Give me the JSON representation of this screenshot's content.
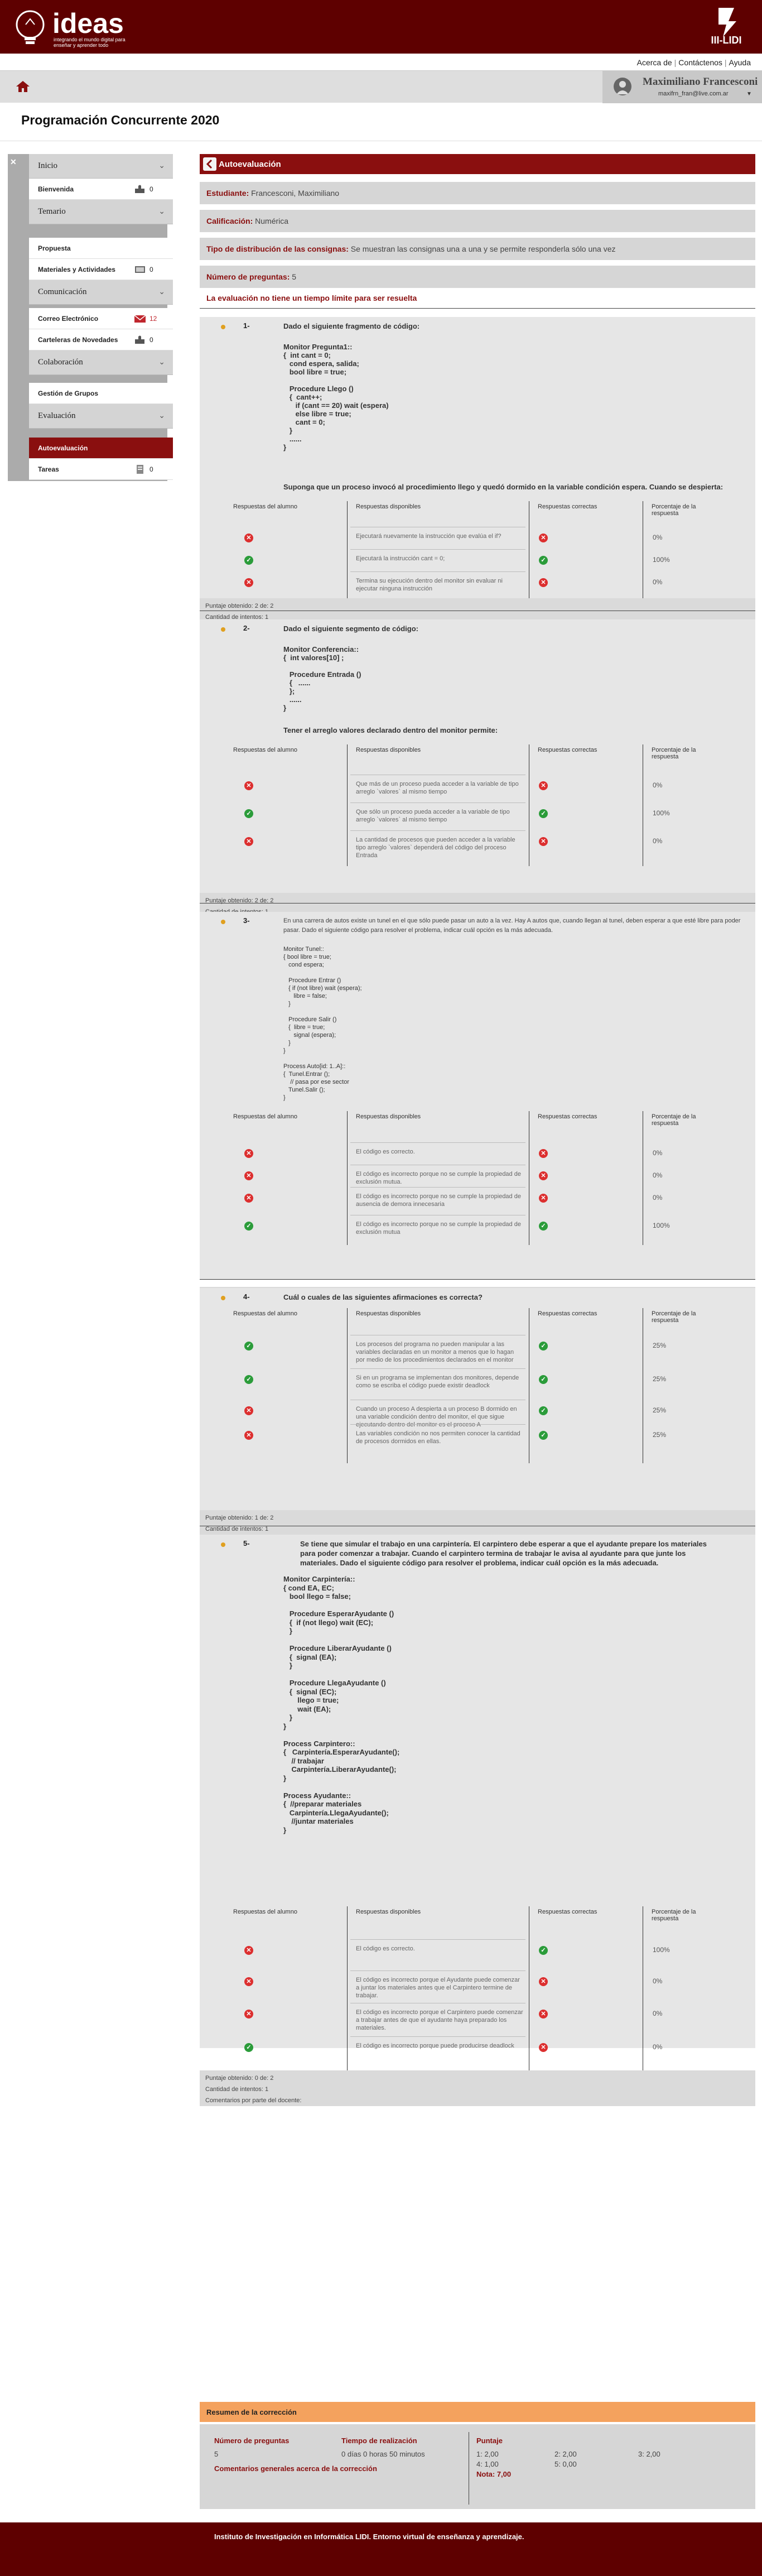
{
  "header": {
    "logo_title": "ideas",
    "logo_tagline": "integrando el mundo digital para enseñar y aprender todo",
    "institute_logo_text": "III-LIDI"
  },
  "top_links": [
    "Acerca de",
    "Contáctenos",
    "Ayuda"
  ],
  "user": {
    "name": "Maximiliano Francesconi",
    "email": "maxifrn_fran@live.com.ar"
  },
  "course_title": "Programación Concurrente 2020",
  "sidebar": {
    "close_glyph": "✕",
    "sections": [
      {
        "label": "Inicio"
      },
      {
        "label": "Temario"
      },
      {
        "label": "Comunicación"
      },
      {
        "label": "Colaboración"
      },
      {
        "label": "Evaluación"
      }
    ],
    "items": [
      {
        "label": "Bienvenida",
        "count": "0",
        "icon": "puzzle-icon"
      },
      {
        "label": "Propuesta",
        "count": "",
        "icon": ""
      },
      {
        "label": "Materiales y Actividades",
        "count": "0",
        "icon": "book-icon"
      },
      {
        "label": "Correo Electrónico",
        "count": "12",
        "icon": "mail-icon"
      },
      {
        "label": "Carteleras de Novedades",
        "count": "0",
        "icon": "puzzle-icon"
      },
      {
        "label": "Gestión de Grupos",
        "count": "",
        "icon": ""
      },
      {
        "label": "Autoevaluación",
        "count": "",
        "icon": ""
      },
      {
        "label": "Tareas",
        "count": "0",
        "icon": "task-icon"
      }
    ]
  },
  "evaluation": {
    "header": "Autoevaluación",
    "student_label": "Estudiante:",
    "student_value": "Francesconi, Maximiliano",
    "grade_label": "Calificación:",
    "grade_value": "Numérica",
    "distribution_label": "Tipo de distribución de las consignas:",
    "distribution_value": "Se muestran las consignas una a una y se permite responderla sólo una vez",
    "count_label": "Número de preguntas:",
    "count_value": "5",
    "no_time_limit": "La evaluación no tiene un tiempo límite para ser resuelta"
  },
  "table_headers": {
    "student": "Respuestas del alumno",
    "available": "Respuestas disponibles",
    "correct": "Respuestas correctas",
    "percent": "Porcentaje de la respuesta"
  },
  "footer_labels": {
    "score": "Puntaje obtenido:",
    "attempts": "Cantidad de intentos:",
    "comments": "Comentarios por parte del docente:"
  },
  "questions": [
    {
      "number": "1-",
      "intro": "Dado el siguiente fragmento de código:",
      "code": "Monitor Pregunta1::\n{  int cant = 0;\n   cond espera, salida;\n   bool libre = true;\n\n   Procedure Llego ()\n   {  cant++;\n      if (cant == 20) wait (espera)\n      else libre = true;\n      cant = 0;\n   }\n   ......\n}",
      "question": "Suponga que un proceso invocó al procedimiento llego y quedó dormido en la variable condición espera. Cuando se despierta:",
      "options": [
        {
          "student": "x",
          "text": "Ejecutará nuevamente la instrucción que evalúa el if?",
          "correct": "x",
          "percent": "0%"
        },
        {
          "student": "ok",
          "text": "Ejecutará la instrucción cant = 0;",
          "correct": "ok",
          "percent": "100%"
        },
        {
          "student": "x",
          "text": "Termina su ejecución dentro del monitor sin evaluar ni ejecutar ninguna instrucción",
          "correct": "x",
          "percent": "0%"
        }
      ],
      "score": "2 de: 2",
      "attempts": "1"
    },
    {
      "number": "2-",
      "intro": "Dado el siguiente segmento de código:",
      "code": "Monitor Conferencia::\n{  int valores[10] ;\n\n   Procedure Entrada ()\n   {   ......\n   };\n   ......\n}",
      "question": "Tener el arreglo valores declarado dentro del monitor permite:",
      "options": [
        {
          "student": "x",
          "text": "Que más de un proceso pueda acceder a la variable de tipo arreglo `valores` al mismo tiempo",
          "correct": "x",
          "percent": "0%"
        },
        {
          "student": "ok",
          "text": "Que sólo un proceso pueda acceder a la variable de tipo arreglo `valores` al mismo tiempo",
          "correct": "ok",
          "percent": "100%"
        },
        {
          "student": "x",
          "text": "La cantidad de procesos que pueden acceder a la variable tipo arreglo `valores` dependerá del código del proceso Entrada",
          "correct": "x",
          "percent": "0%"
        }
      ],
      "score": "2 de: 2",
      "attempts": "1"
    },
    {
      "number": "3-",
      "intro": "En una carrera de autos existe un tunel en el que sólo puede pasar un auto a la vez. Hay A autos que, cuando llegan al tunel, deben esperar a que esté libre para poder pasar. Dado el siguiente código para resolver el problema, indicar cuál opción es la más adecuada.",
      "code": "Monitor Tunel::\n{ bool libre = true;\n   cond espera;\n\n   Procedure Entrar ()\n   { if (not libre) wait (espera);\n      libre = false;\n   }\n\n   Procedure Salir ()\n   {  libre = true;\n      signal (espera);\n   }\n}\n\nProcess Auto[id: 1..A]::\n{  Tunel.Entrar ();\n    // pasa por ese sector\n   Tunel.Salir ();\n}",
      "question": "",
      "options": [
        {
          "student": "x",
          "text": "El código es correcto.",
          "correct": "x",
          "percent": "0%"
        },
        {
          "student": "x",
          "text": "El código es incorrecto porque no se cumple la propiedad de exclusión mutua.",
          "correct": "x",
          "percent": "0%"
        },
        {
          "student": "x",
          "text": "El código es incorrecto porque no se cumple la propiedad de ausencia de demora innecesaria",
          "correct": "x",
          "percent": "0%"
        },
        {
          "student": "ok",
          "text": "El código es incorrecto porque no se cumple la propiedad de exclusión mutua",
          "correct": "ok",
          "percent": "100%"
        }
      ],
      "score": "2 de: 2",
      "attempts": "1"
    },
    {
      "number": "4-",
      "intro": "Cuál o cuales de las siguientes afirmaciones es correcta?",
      "code": "",
      "question": "",
      "options": [
        {
          "student": "ok",
          "text": "Los procesos del programa no pueden manipular a las variables declaradas en un monitor a menos que lo hagan por medio de los procedimientos declarados en el monitor",
          "correct": "ok",
          "percent": "25%"
        },
        {
          "student": "ok",
          "text": "Si en un programa se implementan dos monitores, depende como se escriba el código puede existir deadlock",
          "correct": "ok",
          "percent": "25%"
        },
        {
          "student": "x",
          "text": "Cuando un proceso A despierta a un proceso B dormido en una variable condición dentro del monitor, el que sigue ejecutando dentro del monitor es el proceso A",
          "correct": "ok",
          "percent": "25%"
        },
        {
          "student": "x",
          "text": "Las variables condición no nos permiten conocer la cantidad de procesos dormidos en ellas.",
          "correct": "ok",
          "percent": "25%"
        }
      ],
      "score": "1 de: 2",
      "attempts": "1"
    },
    {
      "number": "5-",
      "intro": "Se tiene que simular el trabajo en una carpintería. El carpintero debe esperar a que el ayudante prepare los materiales para poder comenzar a trabajar. Cuando el carpintero termina de trabajar le avisa al ayudante para que junte los materiales. Dado el siguiente código para resolver el problema, indicar cuál opción es la más adecuada.",
      "code": "Monitor Carpintería::\n{ cond EA, EC;\n   bool llego = false;\n\n   Procedure EsperarAyudante ()\n   {  if (not llego) wait (EC);\n   }\n\n   Procedure LiberarAyudante ()\n   {  signal (EA);\n   }\n\n   Procedure LlegaAyudante ()\n   {  signal (EC);\n       llego = true;\n       wait (EA);\n   }\n}\n\nProcess Carpintero::\n{   Carpintería.EsperarAyudante();\n    // trabajar\n    Carpintería.LiberarAyudante();\n}\n\nProcess Ayudante::\n{  //preparar materiales\n   Carpintería.LlegaAyudante();\n    //juntar materiales\n}",
      "question": "",
      "options": [
        {
          "student": "x",
          "text": "El código es correcto.",
          "correct": "ok",
          "percent": "100%"
        },
        {
          "student": "x",
          "text": "El código es incorrecto porque el Ayudante puede comenzar a juntar los materiales antes que el Carpintero termine de trabajar.",
          "correct": "x",
          "percent": "0%"
        },
        {
          "student": "x",
          "text": "El código es incorrecto porque el Carpintero puede comenzar a trabajar antes de que el ayudante haya preparado los materiales.",
          "correct": "x",
          "percent": "0%"
        },
        {
          "student": "ok",
          "text": "El código es incorrecto porque puede producirse deadlock",
          "correct": "x",
          "percent": "0%"
        }
      ],
      "score": "0 de: 2",
      "attempts": "1"
    }
  ],
  "summary": {
    "title": "Resumen de la corrección",
    "count_label": "Número de preguntas",
    "count_value": "5",
    "time_label": "Tiempo de realización",
    "time_value": "0 días 0 horas 50 minutos",
    "score_label": "Puntaje",
    "scores": [
      "1: 2,00",
      "2: 2,00",
      "3: 2,00",
      "4: 1,00",
      "5: 0,00"
    ],
    "total": "Nota: 7,00",
    "comments_label": "Comentarios generales acerca de la corrección"
  },
  "footer": "Instituto de Investigación en Informática LIDI. Entorno virtual de enseñanza y aprendizaje.",
  "colors": {
    "header": "#5e0000",
    "accent": "#8a0f0f",
    "summary": "#f4a25e",
    "wrong": "#dc2f2f",
    "right": "#2b9c3a"
  }
}
